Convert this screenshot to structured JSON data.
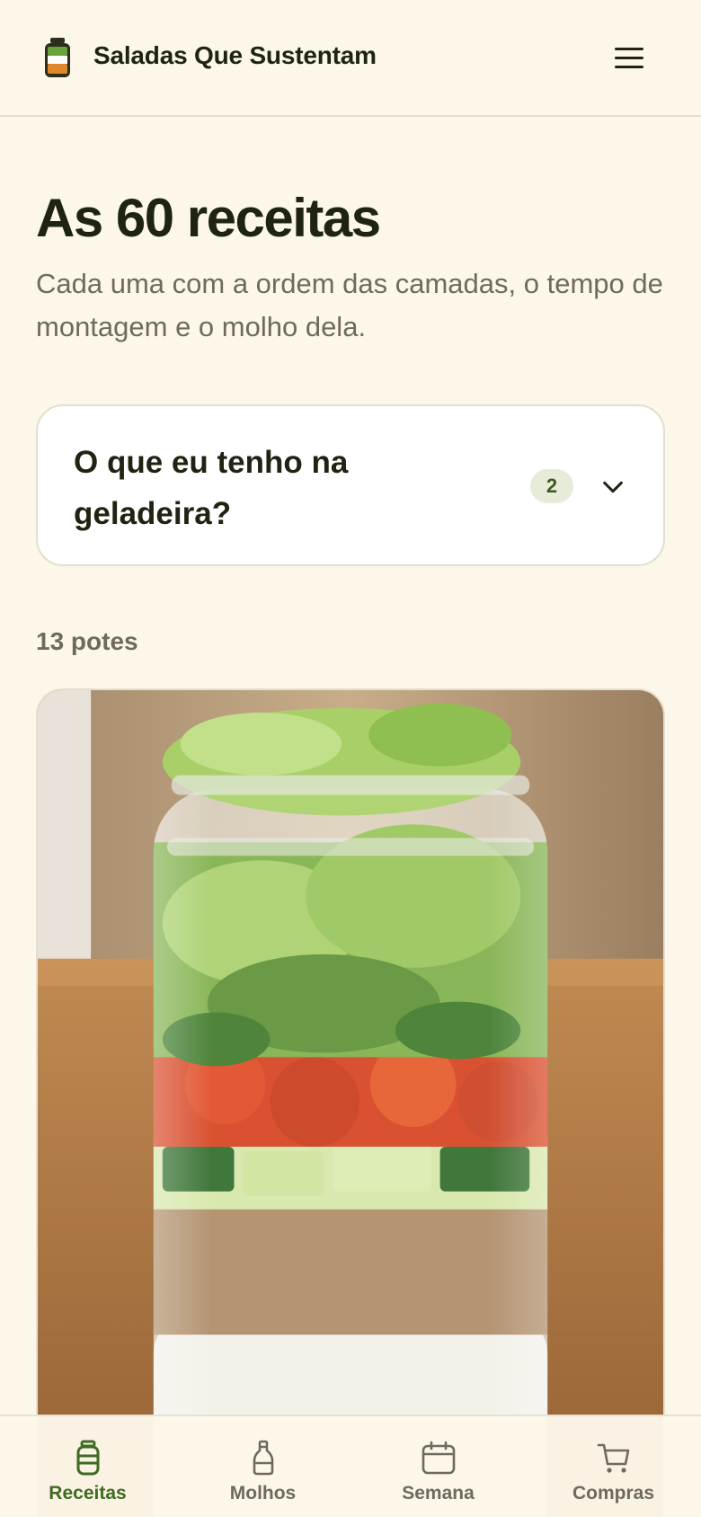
{
  "header": {
    "title": "Saladas Que Sustentam",
    "logo_icon": "jar-logo-icon",
    "menu_icon": "hamburger-menu-icon"
  },
  "main": {
    "title": "As 60 receitas",
    "subtitle": "Cada uma com a ordem das camadas, o tempo de montagem e o molho dela.",
    "filter": {
      "label": "O que eu tenho na geladeira?",
      "badge_count": "2",
      "icon": "chevron-down-icon"
    },
    "count_label": "13 potes",
    "recipes": [
      {
        "image": "salad-jar-photo"
      }
    ]
  },
  "bottom_nav": {
    "items": [
      {
        "label": "Receitas",
        "icon": "jar-icon",
        "active": true
      },
      {
        "label": "Molhos",
        "icon": "bottle-icon",
        "active": false
      },
      {
        "label": "Semana",
        "icon": "calendar-icon",
        "active": false
      },
      {
        "label": "Compras",
        "icon": "cart-icon",
        "active": false
      }
    ]
  },
  "colors": {
    "background": "#fdf7e9",
    "accent": "#3f6b22",
    "text": "#1f2412",
    "muted": "#6f6a5e",
    "badge_bg": "#e6ecd8"
  }
}
